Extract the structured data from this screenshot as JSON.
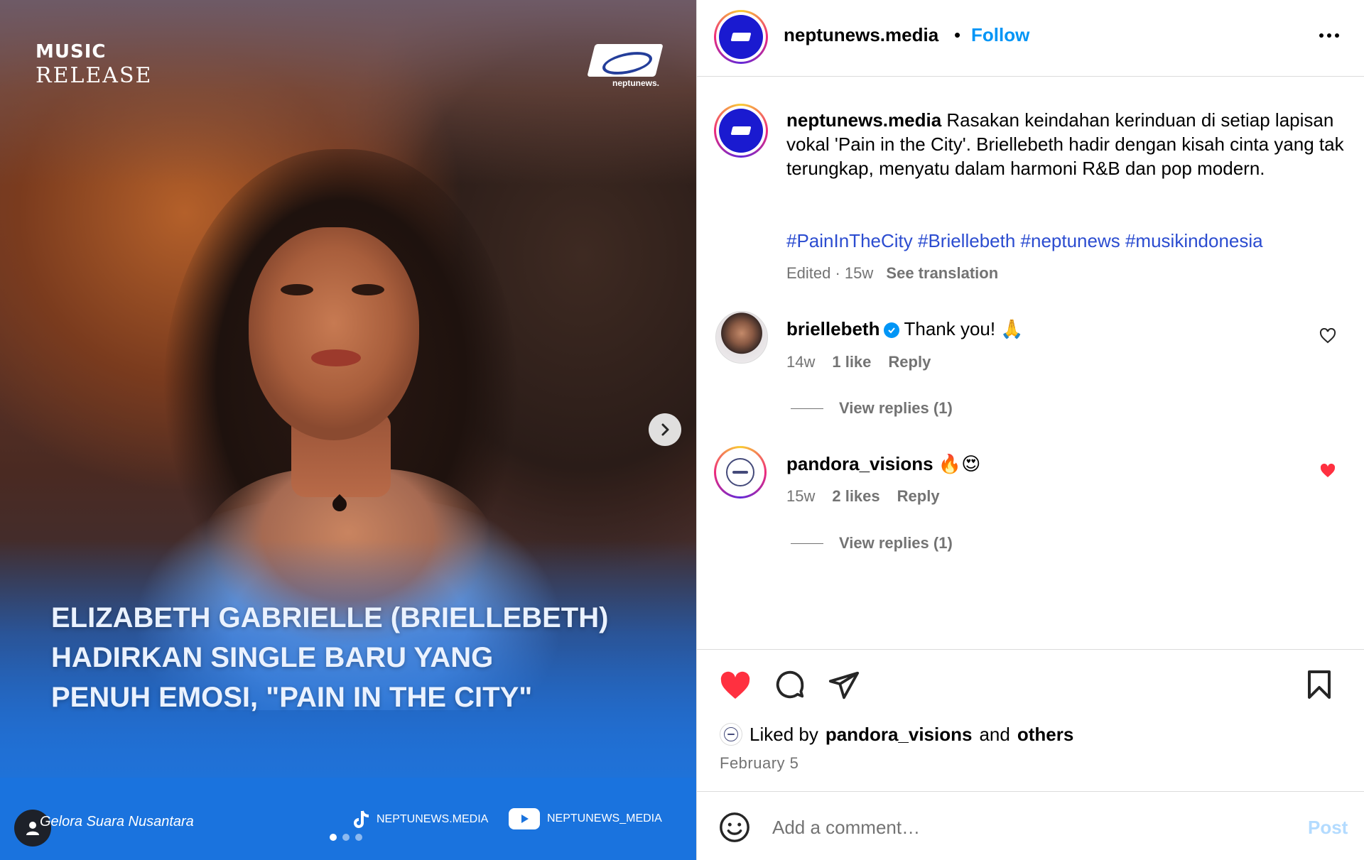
{
  "media": {
    "brand_line1": "MUSIC",
    "brand_line2": "RELEASE",
    "logo_text": "neptunews.",
    "headline": [
      "ELIZABETH GABRIELLE (BRIELLEBETH)",
      "HADIRKAN SINGLE BARU YANG",
      "PENUH EMOSI, \"PAIN IN THE CITY\""
    ],
    "tagline": "Gelora Suara Nusantara",
    "tiktok_handle": "NEPTUNEWS.MEDIA",
    "youtube_handle": "NEPTUNEWS_MEDIA",
    "carousel_total": 3,
    "carousel_active": 1
  },
  "header": {
    "username": "neptunews.media",
    "separator": "•",
    "follow_label": "Follow"
  },
  "caption": {
    "username": "neptunews.media",
    "text": "Rasakan keindahan kerinduan di setiap lapisan vokal 'Pain in the City'. Briellebeth hadir dengan kisah cinta yang tak terungkap, menyatu dalam harmoni R&B dan pop modern.",
    "hashtags": "#PainInTheCity #Briellebeth #neptunews #musikindonesia",
    "edited": "Edited · 15w",
    "see_translation": "See translation"
  },
  "comments": [
    {
      "username": "briellebeth",
      "verified": true,
      "text": "Thank you! 🙏",
      "age": "14w",
      "likes": "1 like",
      "reply_label": "Reply",
      "view_replies": "View replies (1)",
      "liked": false
    },
    {
      "username": "pandora_visions",
      "verified": false,
      "text": "🔥😍",
      "age": "15w",
      "likes": "2 likes",
      "reply_label": "Reply",
      "view_replies": "View replies (1)",
      "liked": true
    }
  ],
  "likes_summary": {
    "prefix": "Liked by",
    "user": "pandora_visions",
    "and": "and",
    "others": "others"
  },
  "date": "February 5",
  "add_comment": {
    "placeholder": "Add a comment…",
    "post_label": "Post"
  },
  "colors": {
    "follow_blue": "#0095f6",
    "hashtag_blue": "#2b4cd0",
    "like_red": "#ff3040",
    "post_disabled": "#b3dbff"
  },
  "icons": [
    "chevron-right-icon",
    "tiktok-icon",
    "youtube-icon",
    "more-options-icon",
    "verified-icon",
    "heart-icon",
    "comment-icon",
    "share-icon",
    "bookmark-icon",
    "emoji-icon"
  ]
}
